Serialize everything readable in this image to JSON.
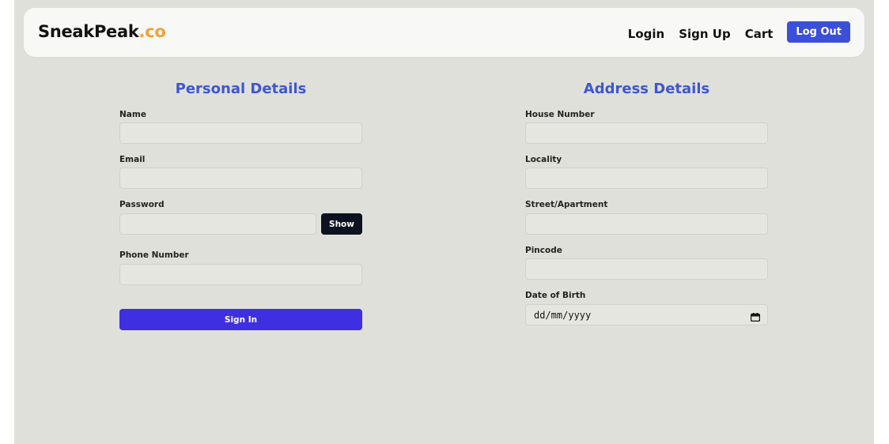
{
  "navbar": {
    "brand_main": "SneakPeak",
    "brand_accent": ".co",
    "links": [
      "Login",
      "Sign Up",
      "Cart"
    ],
    "logout_label": "Log Out"
  },
  "personal": {
    "title": "Personal Details",
    "name_label": "Name",
    "name_value": "",
    "email_label": "Email",
    "email_value": "",
    "password_label": "Password",
    "password_value": "",
    "show_label": "Show",
    "phone_label": "Phone Number",
    "phone_value": "",
    "signin_label": "Sign In"
  },
  "address": {
    "title": "Address Details",
    "house_label": "House Number",
    "house_value": "",
    "locality_label": "Locality",
    "locality_value": "",
    "street_label": "Street/Apartment",
    "street_value": "",
    "pincode_label": "Pincode",
    "pincode_value": "",
    "dob_label": "Date of Birth",
    "dob_placeholder": "dd/mm/yyyy"
  },
  "colors": {
    "accent_blue": "#3d56d6",
    "signin_purple": "#3e2fe0",
    "brand_orange": "#f5a13a",
    "page_bg": "#e0e0da"
  },
  "icons": {
    "date_picker": "calendar-icon"
  }
}
